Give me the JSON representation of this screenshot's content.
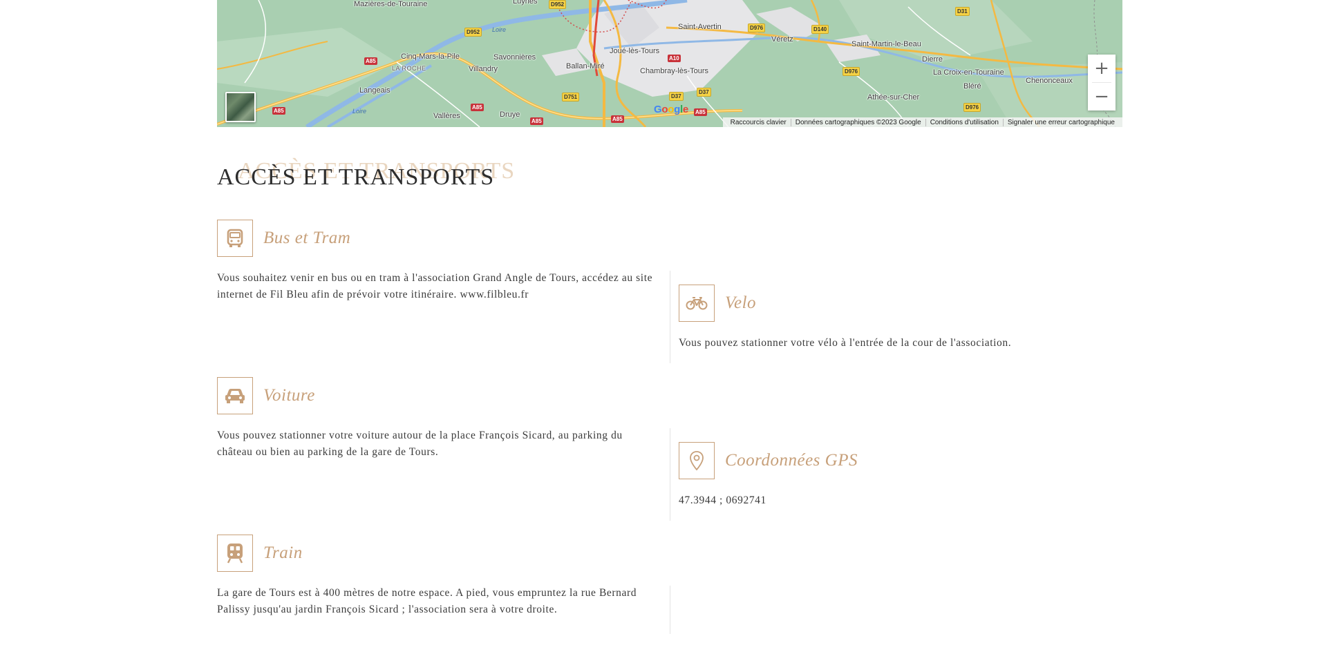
{
  "map": {
    "places": [
      {
        "name": "Mazières-de-Touraine"
      },
      {
        "name": "Luynes"
      },
      {
        "name": "Saint-Avertin"
      },
      {
        "name": "Véretz"
      },
      {
        "name": "Saint-Martin-le-Beau"
      },
      {
        "name": "Cinq-Mars-la-Pile"
      },
      {
        "name": "Savonnières"
      },
      {
        "name": "Joué-lès-Tours"
      },
      {
        "name": "Dierre"
      },
      {
        "name": "Ballan-Miré"
      },
      {
        "name": "Villandry"
      },
      {
        "name": "Chambray-lès-Tours"
      },
      {
        "name": "La Croix-en-Touraine"
      },
      {
        "name": "Chenonceaux"
      },
      {
        "name": "LA ROCHE"
      },
      {
        "name": "Langeais"
      },
      {
        "name": "Bléré"
      },
      {
        "name": "Athée-sur-Cher"
      },
      {
        "name": "Vallères"
      },
      {
        "name": "Druye"
      }
    ],
    "rivers": [
      "Loire",
      "Loire"
    ],
    "roads": [
      "D952",
      "D952",
      "A85",
      "D976",
      "D140",
      "D31",
      "A10",
      "D37",
      "D37",
      "D976",
      "D751",
      "A85",
      "A85",
      "A85",
      "A85",
      "D976",
      "A85"
    ],
    "google_logo": "Google",
    "zoom_in": "+",
    "zoom_out": "−",
    "attribution": [
      "Raccourcis clavier",
      "Données cartographiques ©2023 Google",
      "Conditions d'utilisation",
      "Signaler une erreur cartographique"
    ],
    "colors": {
      "land": "#a9cfb1",
      "water": "#8fb8e6",
      "urban": "#e8e8ea",
      "highway": "#f4b942"
    }
  },
  "section": {
    "title": "ACCÈS ET TRANSPORTS"
  },
  "blocks": [
    {
      "icon": "bus-icon",
      "title": "Bus et Tram",
      "text": "Vous souhaitez venir en bus ou en tram à l'association Grand Angle de Tours, accédez au site internet de Fil Bleu afin de prévoir votre itinéraire. www.filbleu.fr"
    },
    {
      "icon": "bicycle-icon",
      "title": "Velo",
      "text": "Vous pouvez stationner votre vélo à l'entrée de la cour de l'association."
    },
    {
      "icon": "car-icon",
      "title": "Voiture",
      "text": "Vous pouvez stationner votre voiture autour de la place François Sicard, au parking du château ou bien au parking de la gare de Tours."
    },
    {
      "icon": "map-pin-icon",
      "title": "Coordonnées GPS",
      "text": "47.3944 ; 0692741"
    },
    {
      "icon": "train-icon",
      "title": "Train",
      "text": "La gare de Tours est à 400 mètres de notre espace. A pied, vous empruntez la rue Bernard Palissy jusqu'au jardin François Sicard ; l'association sera à votre droite."
    }
  ],
  "accent_color": "#c7a07a"
}
